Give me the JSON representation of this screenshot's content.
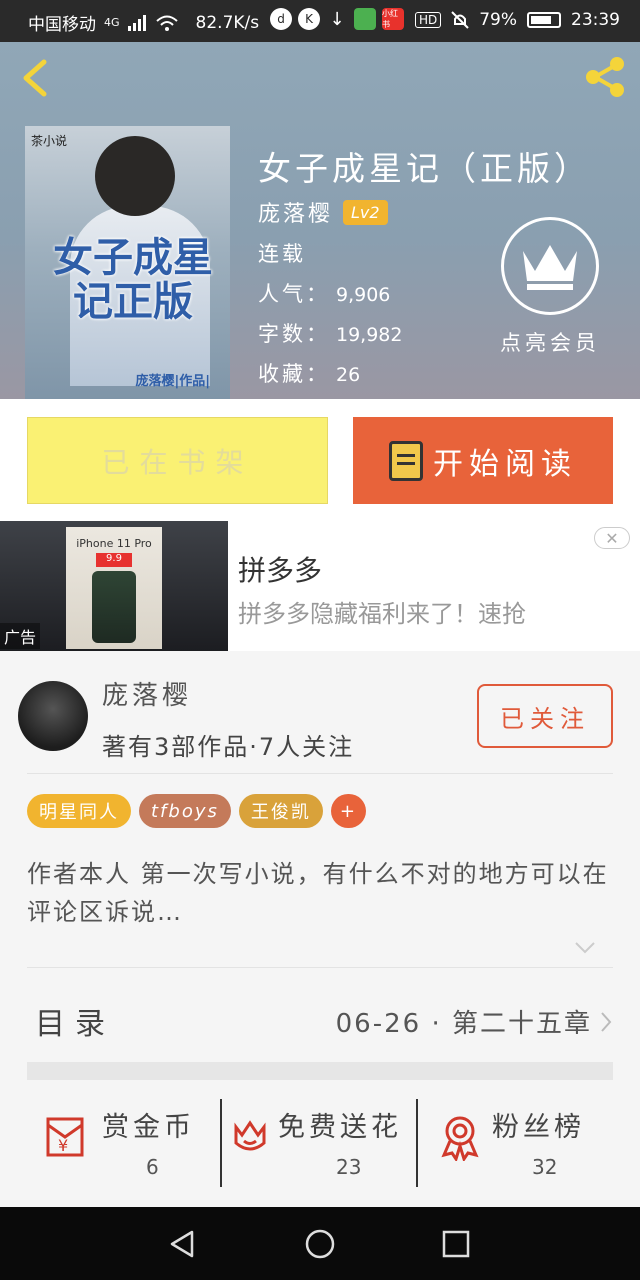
{
  "status_bar": {
    "carrier": "中国移动",
    "network": "4G",
    "speed": "82.7K/s",
    "hd": "HD",
    "battery": "79%",
    "time": "23:39",
    "apps": [
      "d",
      "K",
      "↓",
      "",
      "小红书"
    ]
  },
  "book": {
    "cover": {
      "publisher": "茶小说",
      "title": "女子成星记正版",
      "author_tag": "庞落樱|作品|"
    },
    "title": "女子成星记（正版）",
    "author": "庞落樱",
    "level": "Lv2",
    "status": "连载",
    "popularity_label": "人气：",
    "popularity": "9,906",
    "words_label": "字数：",
    "words": "19,982",
    "favorites_label": "收藏：",
    "favorites": "26",
    "vip_label": "点亮会员"
  },
  "actions": {
    "shelf_label": "已在书架",
    "read_label": "开始阅读"
  },
  "ad": {
    "image_title": "iPhone 11 Pro",
    "image_badge": "9.9",
    "label": "广告",
    "title": "拼多多",
    "desc": "拼多多隐藏福利来了！速抢",
    "close": "✕"
  },
  "author_info": {
    "name": "庞落樱",
    "stats": "著有3部作品·7人关注",
    "follow_label": "已关注",
    "tags": [
      {
        "label": "明星同人",
        "color": "#f1b42f"
      },
      {
        "label": "tfboys",
        "color": "#c47a5a"
      },
      {
        "label": "王俊凯",
        "color": "#d9a23a"
      },
      {
        "label": "+",
        "color": "#e8633a"
      }
    ],
    "intro": "作者本人 第一次写小说，有什么不对的地方可以在评论区诉说…"
  },
  "toc": {
    "label": "目录",
    "latest": "06-26 · 第二十五章"
  },
  "stats": {
    "reward_label": "赏金币",
    "reward_value": "6",
    "flower_label": "免费送花",
    "flower_value": "23",
    "fans_label": "粉丝榜",
    "fans_value": "32"
  },
  "colors": {
    "accent": "#e8633a",
    "shelf_bg": "#faf173",
    "icon_red": "#d0392b"
  }
}
